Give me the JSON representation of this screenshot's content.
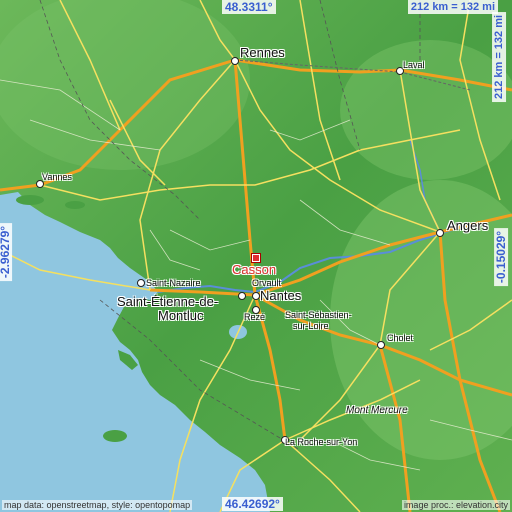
{
  "map": {
    "coord_top": "48.3311°",
    "coord_bottom": "46.42692°",
    "coord_left": "-2.96279°",
    "coord_right": "-0.15029°",
    "scale": "212 km = 132 mi",
    "attribution_left": "map data: openstreetmap, style: opentopomap",
    "attribution_right": "image proc.: elevation.city",
    "colors": {
      "sea": "#8fc6e0",
      "land_low": "#3f9a3c",
      "land_high": "#7cc46a",
      "highway": "#f0a020",
      "road": "#f5e060",
      "coord_text": "#3a5fd0",
      "marker": "#e03030"
    },
    "highlight": "Casson",
    "places": {
      "rennes": "Rennes",
      "laval": "Laval",
      "vannes": "Vannes",
      "angers": "Angers",
      "saint_nazaire": "Saint-Nazaire",
      "orvault": "Orvault",
      "nantes": "Nantes",
      "saint_etienne_1": "Saint-Étienne-de-",
      "saint_etienne_2": "Montluc",
      "reze": "Rezé",
      "saint_sebastien_1": "Saint-Sébastien-",
      "saint_sebastien_2": "sur-Loire",
      "cholet": "Cholet",
      "mont_mercure": "Mont Mercure",
      "la_roche": "La Roche-sur-Yon"
    }
  }
}
